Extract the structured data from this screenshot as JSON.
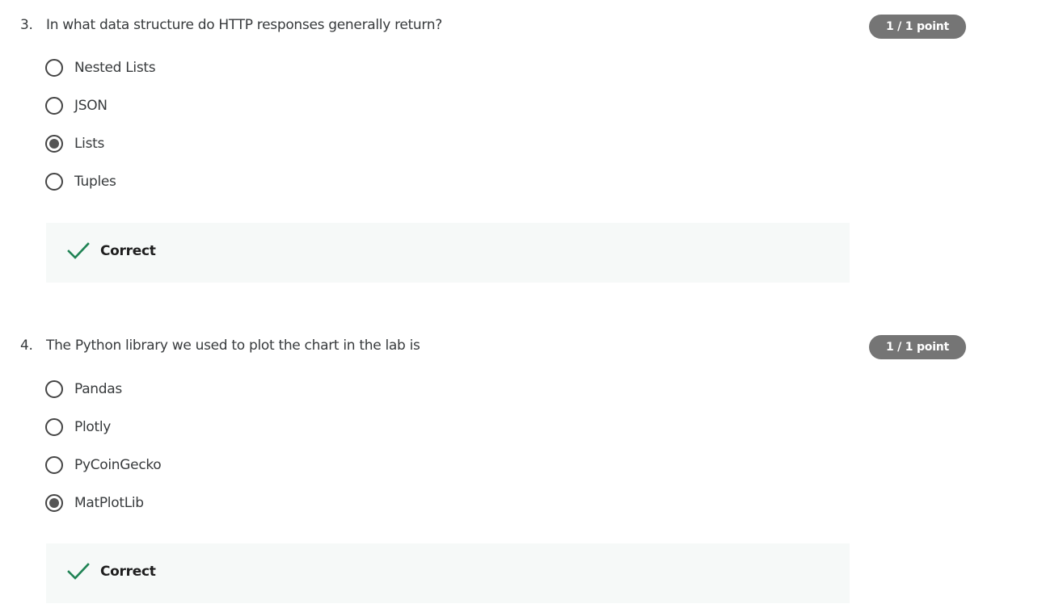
{
  "questions": [
    {
      "number": "3.",
      "text": "In what data structure do HTTP responses generally return?",
      "score": "1 / 1 point",
      "options": [
        {
          "label": "Nested Lists",
          "selected": false
        },
        {
          "label": "JSON",
          "selected": false
        },
        {
          "label": "Lists",
          "selected": true
        },
        {
          "label": "Tuples",
          "selected": false
        }
      ],
      "feedback": "Correct"
    },
    {
      "number": "4.",
      "text": "The Python library we used to plot the chart in the lab is",
      "score": "1 / 1 point",
      "options": [
        {
          "label": "Pandas",
          "selected": false
        },
        {
          "label": "Plotly",
          "selected": false
        },
        {
          "label": "PyCoinGecko",
          "selected": false
        },
        {
          "label": "MatPlotLib",
          "selected": true
        }
      ],
      "feedback": "Correct"
    }
  ],
  "colors": {
    "badge_bg": "#757575",
    "check_green": "#1f8354",
    "feedback_bg": "#f6f9f8"
  }
}
